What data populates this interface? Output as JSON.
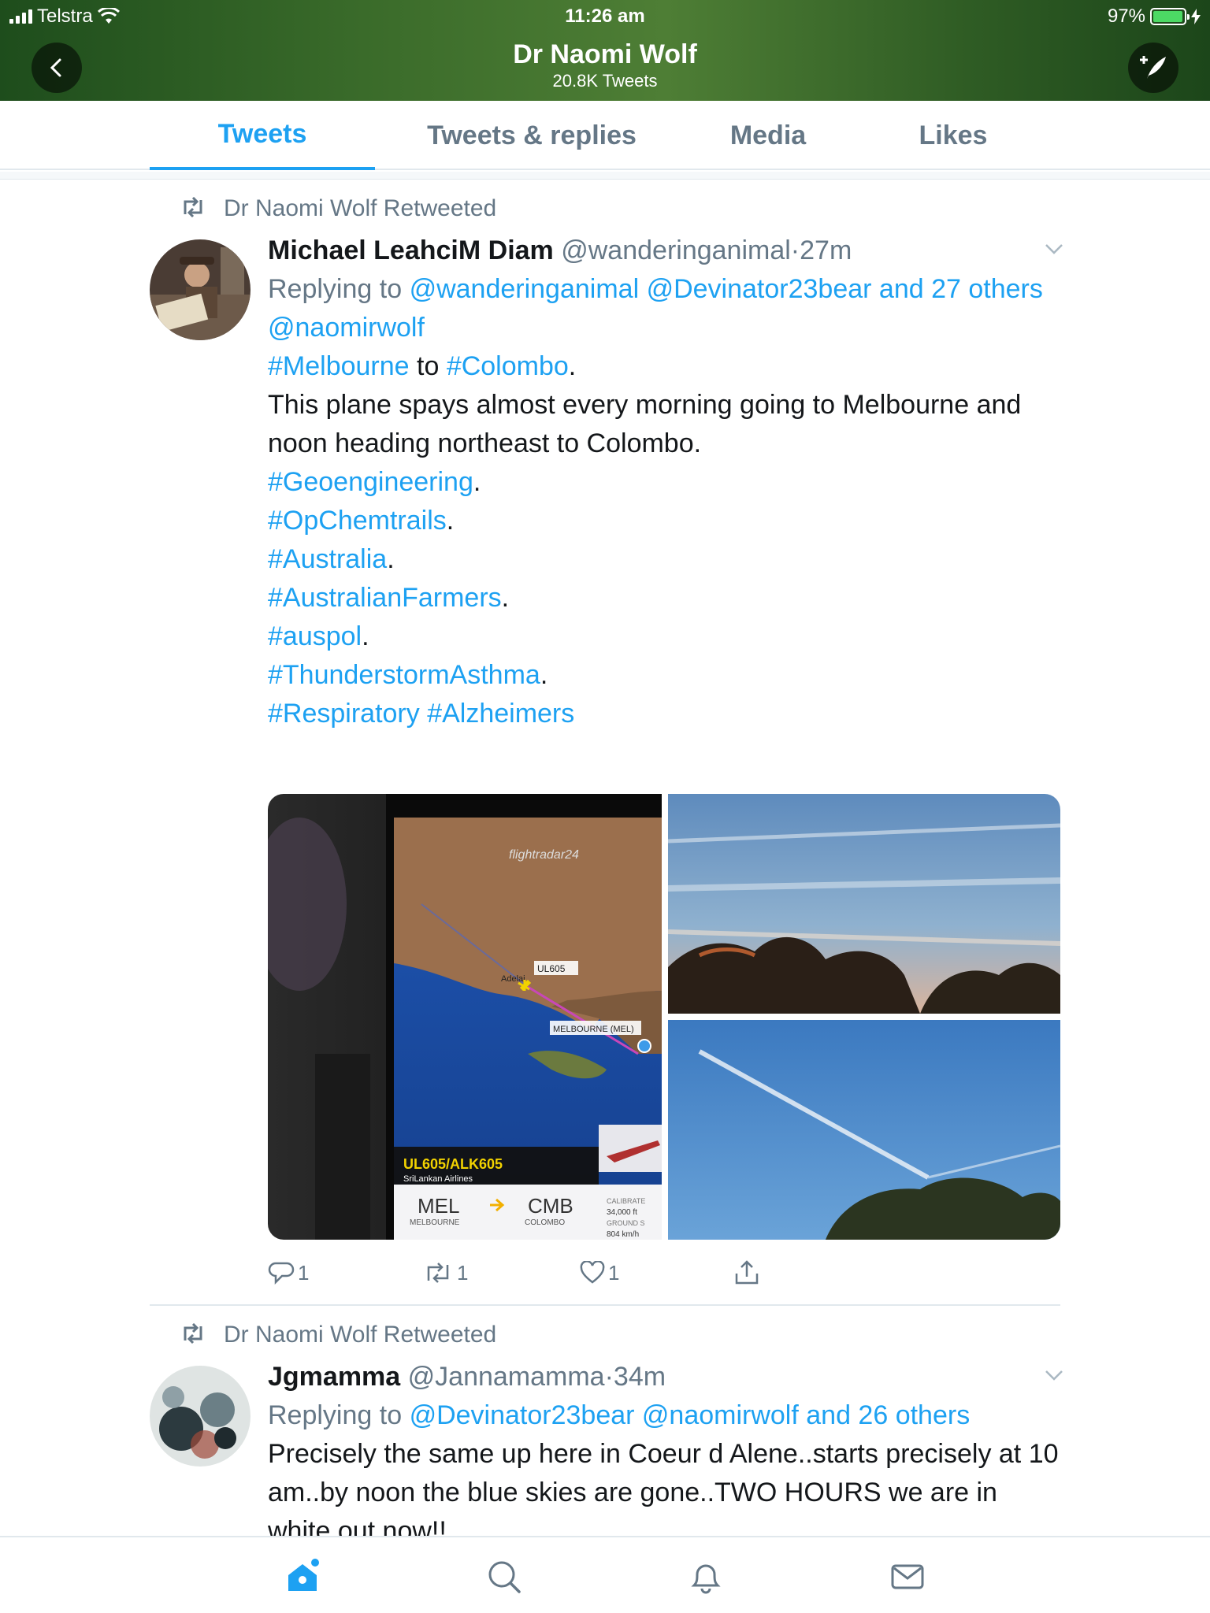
{
  "status_bar": {
    "carrier": "Telstra",
    "time": "11:26 am",
    "battery": "97%",
    "battery_level": 0.97
  },
  "header": {
    "title": "Dr Naomi Wolf",
    "subtitle": "20.8K Tweets",
    "back_icon": "chevron-left-icon",
    "compose_icon": "compose-tweet-icon"
  },
  "tabs": [
    {
      "label": "Tweets",
      "active": true
    },
    {
      "label": "Tweets & replies",
      "active": false
    },
    {
      "label": "Media",
      "active": false
    },
    {
      "label": "Likes",
      "active": false
    }
  ],
  "tweets": [
    {
      "retweet_label": "Dr Naomi Wolf Retweeted",
      "name": "Michael LeahciM Diam",
      "handle": "@wanderinganimal",
      "dot": "·",
      "time": "27m",
      "replying_prefix": "Replying to",
      "replying_handles": "@wanderinganimal @Devinator23bear and 27 others",
      "lines": {
        "mention": "@naomirwolf",
        "tag_melbourne": "#Melbourne",
        "to": " to ",
        "tag_colombo": "#Colombo",
        "dot1": ".",
        "body": "This plane spays almost every morning going to Melbourne and noon heading northeast to Colombo.",
        "tag_geo": "#Geoengineering",
        "tag_chem": "#OpChemtrails",
        "tag_aus": "#Australia",
        "tag_farmers": "#AustralianFarmers",
        "tag_auspol": "#auspol",
        "tag_asthma": "#ThunderstormAsthma",
        "tag_resp": "#Respiratory #Alzheimers",
        "period": "."
      },
      "media": {
        "app_name": "flightradar24",
        "flight_label": "UL605",
        "city_label": "MELBOURNE (MEL)",
        "adelaide": "Adelai",
        "callsign": "UL605/ALK605",
        "airline": "SriLankan Airlines",
        "from_code": "MEL",
        "from_city": "MELBOURNE",
        "to_code": "CMB",
        "to_city": "COLOMBO",
        "altitude_label": "CALIBRATE",
        "altitude": "34,000 ft",
        "speed_label": "GROUND S",
        "speed": "804 km/h"
      },
      "actions": {
        "replies": "1",
        "retweets": "1",
        "likes": "1"
      }
    },
    {
      "retweet_label": "Dr Naomi Wolf Retweeted",
      "name": "Jgmamma",
      "handle": "@Jannamamma",
      "dot": "·",
      "time": "34m",
      "replying_prefix": "Replying to",
      "replying_handles": "@Devinator23bear @naomirwolf and 26 others",
      "body": "Precisely the same up here in Coeur d Alene..starts precisely at 10 am..by noon the blue skies are gone..TWO HOURS we are in white out now!!"
    }
  ],
  "bottom_nav": [
    "home-icon",
    "search-icon",
    "notifications-icon",
    "messages-icon"
  ],
  "colors": {
    "accent": "#1da1f2",
    "text": "#14171a",
    "muted": "#657786",
    "header_green": "#3a6b2a"
  }
}
